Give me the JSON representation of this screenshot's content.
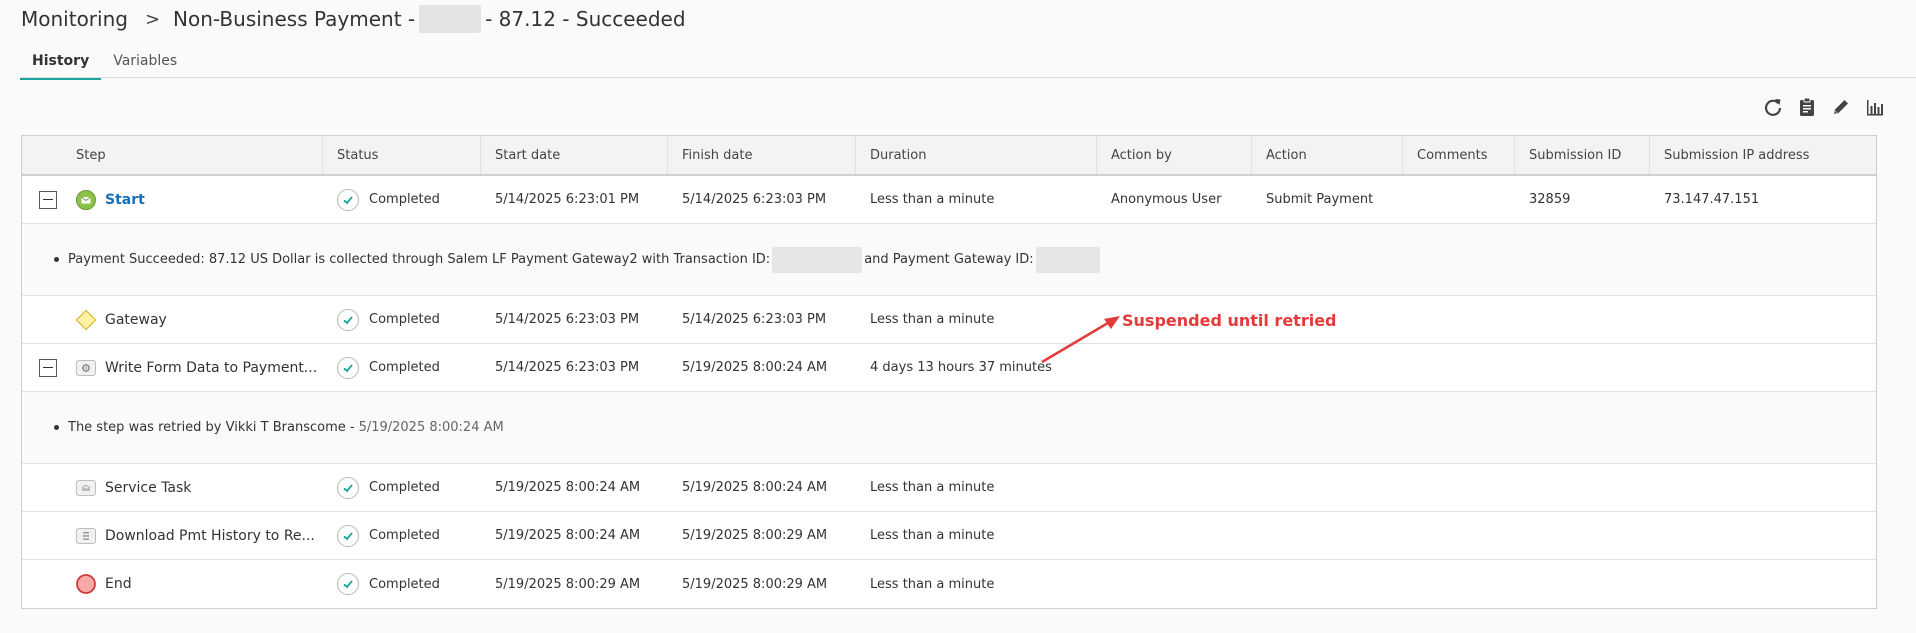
{
  "breadcrumb": {
    "root": "Monitoring",
    "separator": ">",
    "title_prefix": "Non-Business Payment -",
    "title_suffix": "- 87.12 - Succeeded"
  },
  "tabs": [
    {
      "label": "History",
      "active": true
    },
    {
      "label": "Variables",
      "active": false
    }
  ],
  "toolbar": {
    "icons": [
      "refresh-icon",
      "clipboard-icon",
      "pencil-icon",
      "bar-chart-icon"
    ]
  },
  "columns": [
    "Step",
    "Status",
    "Start date",
    "Finish date",
    "Duration",
    "Action by",
    "Action",
    "Comments",
    "Submission ID",
    "Submission IP address"
  ],
  "rows": [
    {
      "step": "Start",
      "icon": "email-start-icon",
      "expandable": true,
      "status": "Completed",
      "start": "5/14/2025 6:23:01 PM",
      "finish": "5/14/2025 6:23:03 PM",
      "duration": "Less than a minute",
      "action_by": "Anonymous User",
      "action": "Submit Payment",
      "comments": "",
      "submission_id": "32859",
      "ip": "73.147.47.151"
    },
    {
      "step": "Gateway",
      "icon": "gateway-diamond-icon",
      "expandable": false,
      "status": "Completed",
      "start": "5/14/2025 6:23:03 PM",
      "finish": "5/14/2025 6:23:03 PM",
      "duration": "Less than a minute"
    },
    {
      "step": "Write Form Data to Payment...",
      "icon": "gear-task-icon",
      "expandable": true,
      "status": "Completed",
      "start": "5/14/2025 6:23:03 PM",
      "finish": "5/19/2025 8:00:24 AM",
      "duration": "4 days 13 hours 37 minutes"
    },
    {
      "step": "Service Task",
      "icon": "service-task-icon",
      "expandable": false,
      "status": "Completed",
      "start": "5/19/2025 8:00:24 AM",
      "finish": "5/19/2025 8:00:24 AM",
      "duration": "Less than a minute"
    },
    {
      "step": "Download Pmt History to Re...",
      "icon": "list-task-icon",
      "expandable": false,
      "status": "Completed",
      "start": "5/19/2025 8:00:24 AM",
      "finish": "5/19/2025 8:00:29 AM",
      "duration": "Less than a minute"
    },
    {
      "step": "End",
      "icon": "end-event-icon",
      "expandable": false,
      "status": "Completed",
      "start": "5/19/2025 8:00:29 AM",
      "finish": "5/19/2025 8:00:29 AM",
      "duration": "Less than a minute"
    }
  ],
  "details": {
    "start": {
      "text_before": "Payment Succeeded: 87.12 US Dollar is collected through Salem LF Payment Gateway2 with Transaction ID:",
      "text_middle": "and Payment Gateway ID:"
    },
    "write": {
      "text": "The step was retried by Vikki T Branscome -",
      "time": "5/19/2025 8:00:24 AM"
    }
  },
  "annotation": {
    "text": "Suspended until retried",
    "color": "#e53a3a"
  },
  "colors": {
    "accent": "#1ba39c",
    "link": "#1670b5",
    "start_event": "#8bc34a",
    "end_event": "#f28b8b"
  }
}
